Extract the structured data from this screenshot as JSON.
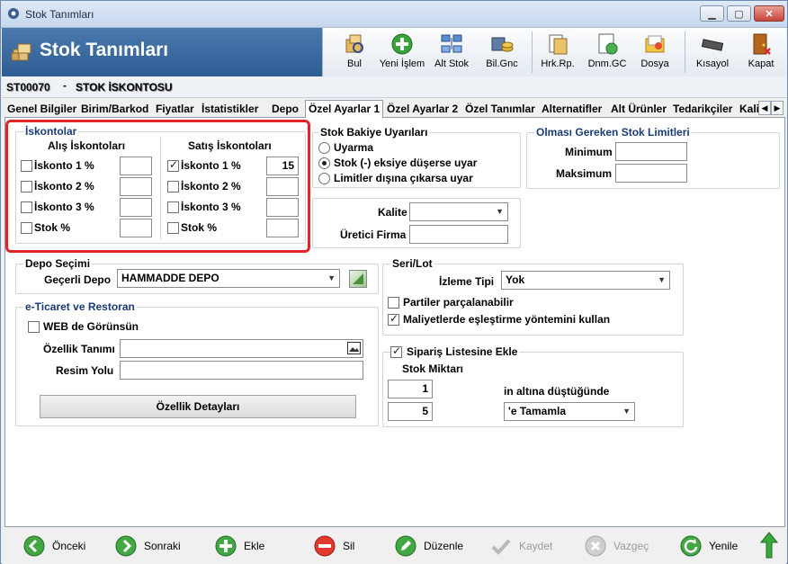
{
  "window": {
    "title": "Stok Tanımları",
    "minimize": "▁",
    "maximize": "▢",
    "close": "✕"
  },
  "header": {
    "module_title": "Stok Tanımları",
    "toolbar": [
      {
        "label": "Bul",
        "icon": "find-icon"
      },
      {
        "label": "Yeni İşlem",
        "icon": "add-icon"
      },
      {
        "label": "Alt Stok",
        "icon": "sub-stock-icon"
      },
      {
        "label": "Bil.Gnc",
        "icon": "update-info-icon"
      },
      {
        "label": "Hrk.Rp.",
        "icon": "movement-report-icon"
      },
      {
        "label": "Dnm.GC",
        "icon": "period-icon"
      },
      {
        "label": "Dosya",
        "icon": "file-icon"
      },
      {
        "label": "Kısayol",
        "icon": "shortcut-icon"
      },
      {
        "label": "Kapat",
        "icon": "exit-icon"
      }
    ]
  },
  "record": {
    "code": "ST00070",
    "separator": "-",
    "name": "STOK İSKONTOSU"
  },
  "tabs": [
    {
      "label": "Genel Bilgiler"
    },
    {
      "label": "Birim/Barkod"
    },
    {
      "label": "Fiyatlar"
    },
    {
      "label": "İstatistikler"
    },
    {
      "label": "Depo"
    },
    {
      "label": "Özel Ayarlar 1",
      "active": true
    },
    {
      "label": "Özel Ayarlar 2"
    },
    {
      "label": "Özel Tanımlar"
    },
    {
      "label": "Alternatifler"
    },
    {
      "label": "Alt Ürünler"
    },
    {
      "label": "Tedarikçiler"
    },
    {
      "label": "Kali"
    }
  ],
  "iskontolar": {
    "title": "İskontolar",
    "alis_header": "Alış İskontoları",
    "satis_header": "Satış İskontoları",
    "alis": [
      {
        "label": "İskonto 1 %",
        "checked": false,
        "value": ""
      },
      {
        "label": "İskonto 2 %",
        "checked": false,
        "value": ""
      },
      {
        "label": "İskonto 3 %",
        "checked": false,
        "value": ""
      },
      {
        "label": "Stok %",
        "checked": false,
        "value": ""
      }
    ],
    "satis": [
      {
        "label": "İskonto 1 %",
        "checked": true,
        "value": "15"
      },
      {
        "label": "İskonto 2 %",
        "checked": false,
        "value": ""
      },
      {
        "label": "İskonto 3 %",
        "checked": false,
        "value": ""
      },
      {
        "label": "Stok %",
        "checked": false,
        "value": ""
      }
    ]
  },
  "bakiye": {
    "title": "Stok Bakiye Uyarıları",
    "options": [
      "Uyarma",
      "Stok (-) eksiye düşerse uyar",
      "Limitler dışına çıkarsa uyar"
    ],
    "selected": 1
  },
  "limitler": {
    "title": "Olması Gereken Stok Limitleri",
    "minimum_label": "Minimum",
    "minimum_value": "",
    "maksimum_label": "Maksimum",
    "maksimum_value": ""
  },
  "kalite": {
    "kalite_label": "Kalite",
    "kalite_value": "",
    "uretici_label": "Üretici Firma",
    "uretici_value": ""
  },
  "depo": {
    "title": "Depo Seçimi",
    "label": "Geçerli Depo",
    "value": "HAMMADDE DEPO"
  },
  "seri": {
    "title": "Seri/Lot",
    "izleme_label": "İzleme Tipi",
    "izleme_value": "Yok",
    "partiler_label": "Partiler parçalanabilir",
    "partiler_checked": false,
    "maliyet_label": "Maliyetlerde eşleştirme yöntemini kullan",
    "maliyet_checked": true
  },
  "eticaret": {
    "title": "e-Ticaret ve Restoran",
    "web_label": "WEB de Görünsün",
    "web_checked": false,
    "ozellik_label": "Özellik Tanımı",
    "ozellik_value": "",
    "resim_label": "Resim Yolu",
    "resim_value": "",
    "detay_button": "Özellik Detayları"
  },
  "siparis": {
    "checkbox_label": "Sipariş Listesine Ekle",
    "checked": true,
    "miktar_label": "Stok Miktarı",
    "miktar_value": "1",
    "below_text": "in altına düştüğünde",
    "second_value": "5",
    "tamamla_value": "'e Tamamla"
  },
  "navigation": [
    {
      "label": "Önceki",
      "icon": "previous-icon",
      "enabled": true
    },
    {
      "label": "Sonraki",
      "icon": "next-icon",
      "enabled": true
    },
    {
      "label": "Ekle",
      "icon": "add-record-icon",
      "enabled": true
    },
    {
      "label": "Sil",
      "icon": "delete-icon",
      "enabled": true
    },
    {
      "label": "Düzenle",
      "icon": "edit-icon",
      "enabled": true
    },
    {
      "label": "Kaydet",
      "icon": "save-icon",
      "enabled": false
    },
    {
      "label": "Vazgeç",
      "icon": "cancel-icon",
      "enabled": false
    },
    {
      "label": "Yenile",
      "icon": "refresh-icon",
      "enabled": true
    }
  ],
  "colors": {
    "banner": "#3a6aa0",
    "highlight": "#e0262a",
    "group_title": "#1a3b76"
  }
}
